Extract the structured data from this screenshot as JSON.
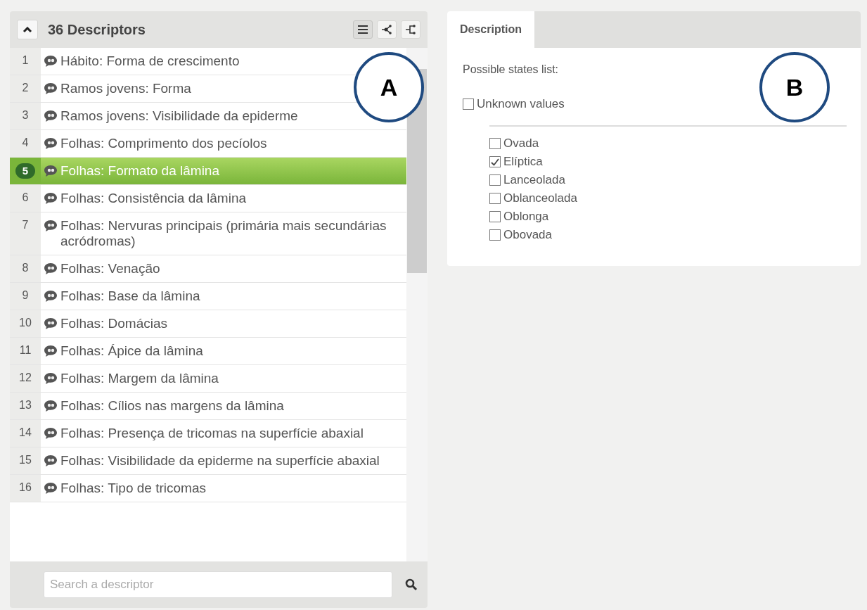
{
  "descriptors_panel": {
    "title": "36 Descriptors",
    "view_buttons": [
      {
        "kind": "list",
        "selected": true
      },
      {
        "kind": "tree",
        "selected": false
      },
      {
        "kind": "branch",
        "selected": false
      }
    ],
    "descriptors": [
      {
        "number": "1",
        "label": "Hábito: Forma de crescimento",
        "selected": false
      },
      {
        "number": "2",
        "label": "Ramos jovens: Forma",
        "selected": false
      },
      {
        "number": "3",
        "label": "Ramos jovens: Visibilidade da epiderme",
        "selected": false
      },
      {
        "number": "4",
        "label": "Folhas: Comprimento dos pecíolos",
        "selected": false
      },
      {
        "number": "5",
        "label": "Folhas: Formato da lâmina",
        "selected": true
      },
      {
        "number": "6",
        "label": "Folhas: Consistência da lâmina",
        "selected": false
      },
      {
        "number": "7",
        "label": "Folhas: Nervuras principais (primária mais secundárias acródromas)",
        "selected": false
      },
      {
        "number": "8",
        "label": "Folhas: Venação",
        "selected": false
      },
      {
        "number": "9",
        "label": "Folhas: Base da lâmina",
        "selected": false
      },
      {
        "number": "10",
        "label": "Folhas: Domácias",
        "selected": false
      },
      {
        "number": "11",
        "label": "Folhas: Ápice da lâmina",
        "selected": false
      },
      {
        "number": "12",
        "label": "Folhas: Margem da lâmina",
        "selected": false
      },
      {
        "number": "13",
        "label": "Folhas: Cílios nas margens da lâmina",
        "selected": false
      },
      {
        "number": "14",
        "label": "Folhas: Presença de tricomas na superfície abaxial",
        "selected": false
      },
      {
        "number": "15",
        "label": "Folhas: Visibilidade da epiderme na superfície abaxial",
        "selected": false
      },
      {
        "number": "16",
        "label": "Folhas: Tipo de tricomas",
        "selected": false
      }
    ],
    "search": {
      "placeholder": "Search a descriptor"
    }
  },
  "detail_panel": {
    "tabs": [
      {
        "label": "Description",
        "selected": true
      }
    ],
    "heading": "Possible states list:",
    "unknown_values": {
      "label": "Unknown values",
      "checked": false
    },
    "states": [
      {
        "label": "Ovada",
        "checked": false
      },
      {
        "label": "Elíptica",
        "checked": true
      },
      {
        "label": "Lanceolada",
        "checked": false
      },
      {
        "label": "Oblanceolada",
        "checked": false
      },
      {
        "label": "Oblonga",
        "checked": false
      },
      {
        "label": "Obovada",
        "checked": false
      }
    ]
  },
  "callouts": [
    {
      "label": "A"
    },
    {
      "label": "B"
    }
  ]
}
